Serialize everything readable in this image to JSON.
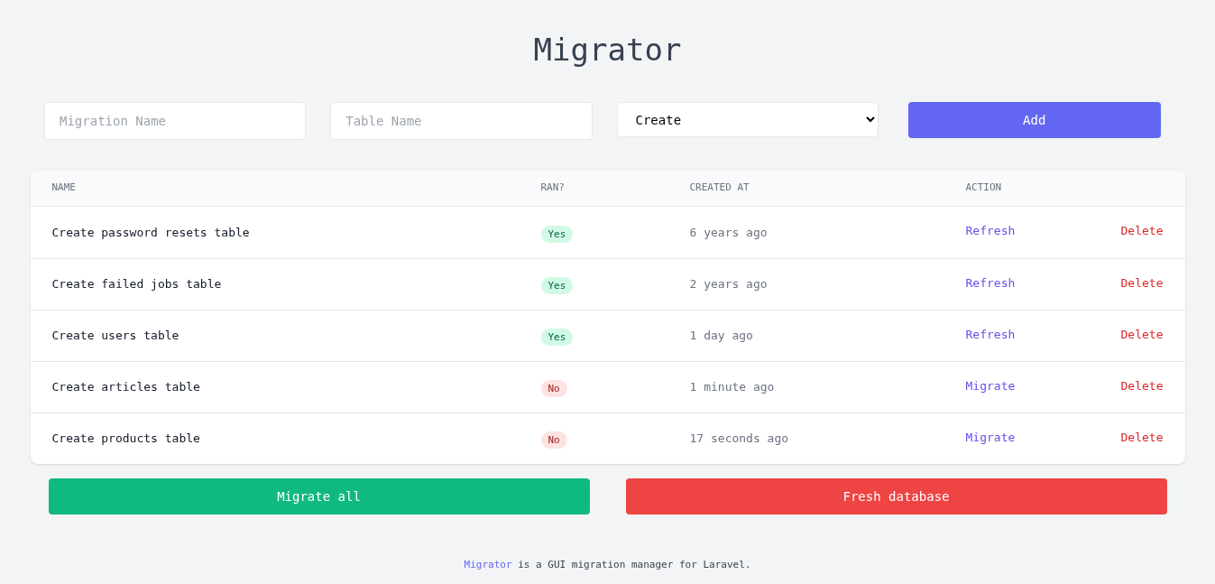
{
  "title": "Migrator",
  "form": {
    "migration_name": {
      "placeholder": "Migration Name"
    },
    "table_name": {
      "placeholder": "Table Name"
    },
    "type_select": {
      "value": "Create"
    },
    "add_button": "Add"
  },
  "table": {
    "columns": [
      "NAME",
      "RAN?",
      "CREATED AT",
      "ACTION"
    ],
    "rows": [
      {
        "name": "Create password resets table",
        "ran": true,
        "ran_label": "Yes",
        "created_at": "6 years ago",
        "action": "Refresh",
        "delete": "Delete"
      },
      {
        "name": "Create failed jobs table",
        "ran": true,
        "ran_label": "Yes",
        "created_at": "2 years ago",
        "action": "Refresh",
        "delete": "Delete"
      },
      {
        "name": "Create users table",
        "ran": true,
        "ran_label": "Yes",
        "created_at": "1 day ago",
        "action": "Refresh",
        "delete": "Delete"
      },
      {
        "name": "Create articles table",
        "ran": false,
        "ran_label": "No",
        "created_at": "1 minute ago",
        "action": "Migrate",
        "delete": "Delete"
      },
      {
        "name": "Create products table",
        "ran": false,
        "ran_label": "No",
        "created_at": "17 seconds ago",
        "action": "Migrate",
        "delete": "Delete"
      }
    ]
  },
  "buttons": {
    "migrate_all": "Migrate all",
    "fresh_database": "Fresh database"
  },
  "footer": {
    "link": "Migrator",
    "text": "is a GUI migration manager for Laravel."
  }
}
